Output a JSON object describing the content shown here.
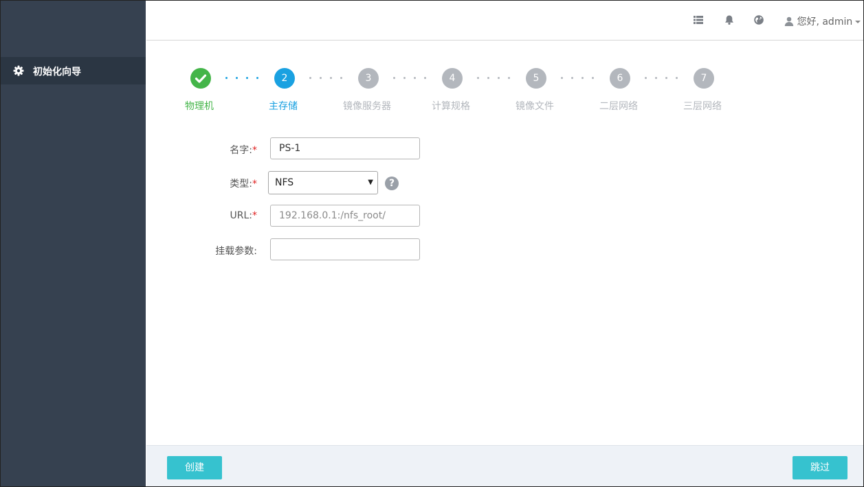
{
  "sidebar": {
    "items": [
      {
        "label": "初始化向导",
        "icon": "gear-icon"
      }
    ]
  },
  "header": {
    "icons": [
      "list-icon",
      "bell-icon",
      "globe-icon"
    ],
    "user_label": "您好, admin"
  },
  "wizard": {
    "steps": [
      {
        "number": "1",
        "label": "物理机",
        "state": "done"
      },
      {
        "number": "2",
        "label": "主存储",
        "state": "active"
      },
      {
        "number": "3",
        "label": "镜像服务器",
        "state": "pending"
      },
      {
        "number": "4",
        "label": "计算规格",
        "state": "pending"
      },
      {
        "number": "5",
        "label": "镜像文件",
        "state": "pending"
      },
      {
        "number": "6",
        "label": "二层网络",
        "state": "pending"
      },
      {
        "number": "7",
        "label": "三层网络",
        "state": "pending"
      }
    ],
    "colors": {
      "done": "#44b549",
      "active": "#1aa1e1",
      "pending": "#b3b7bd"
    }
  },
  "form": {
    "name": {
      "label": "名字:",
      "required": "*",
      "value": "PS-1"
    },
    "type": {
      "label": "类型:",
      "required": "*",
      "value": "NFS",
      "help": "?"
    },
    "url": {
      "label": "URL:",
      "required": "*",
      "placeholder": "192.168.0.1:/nfs_root/"
    },
    "mount": {
      "label": "挂载参数:",
      "value": ""
    }
  },
  "footer": {
    "create_label": "创建",
    "skip_label": "跳过",
    "accent": "#36c2cf"
  }
}
